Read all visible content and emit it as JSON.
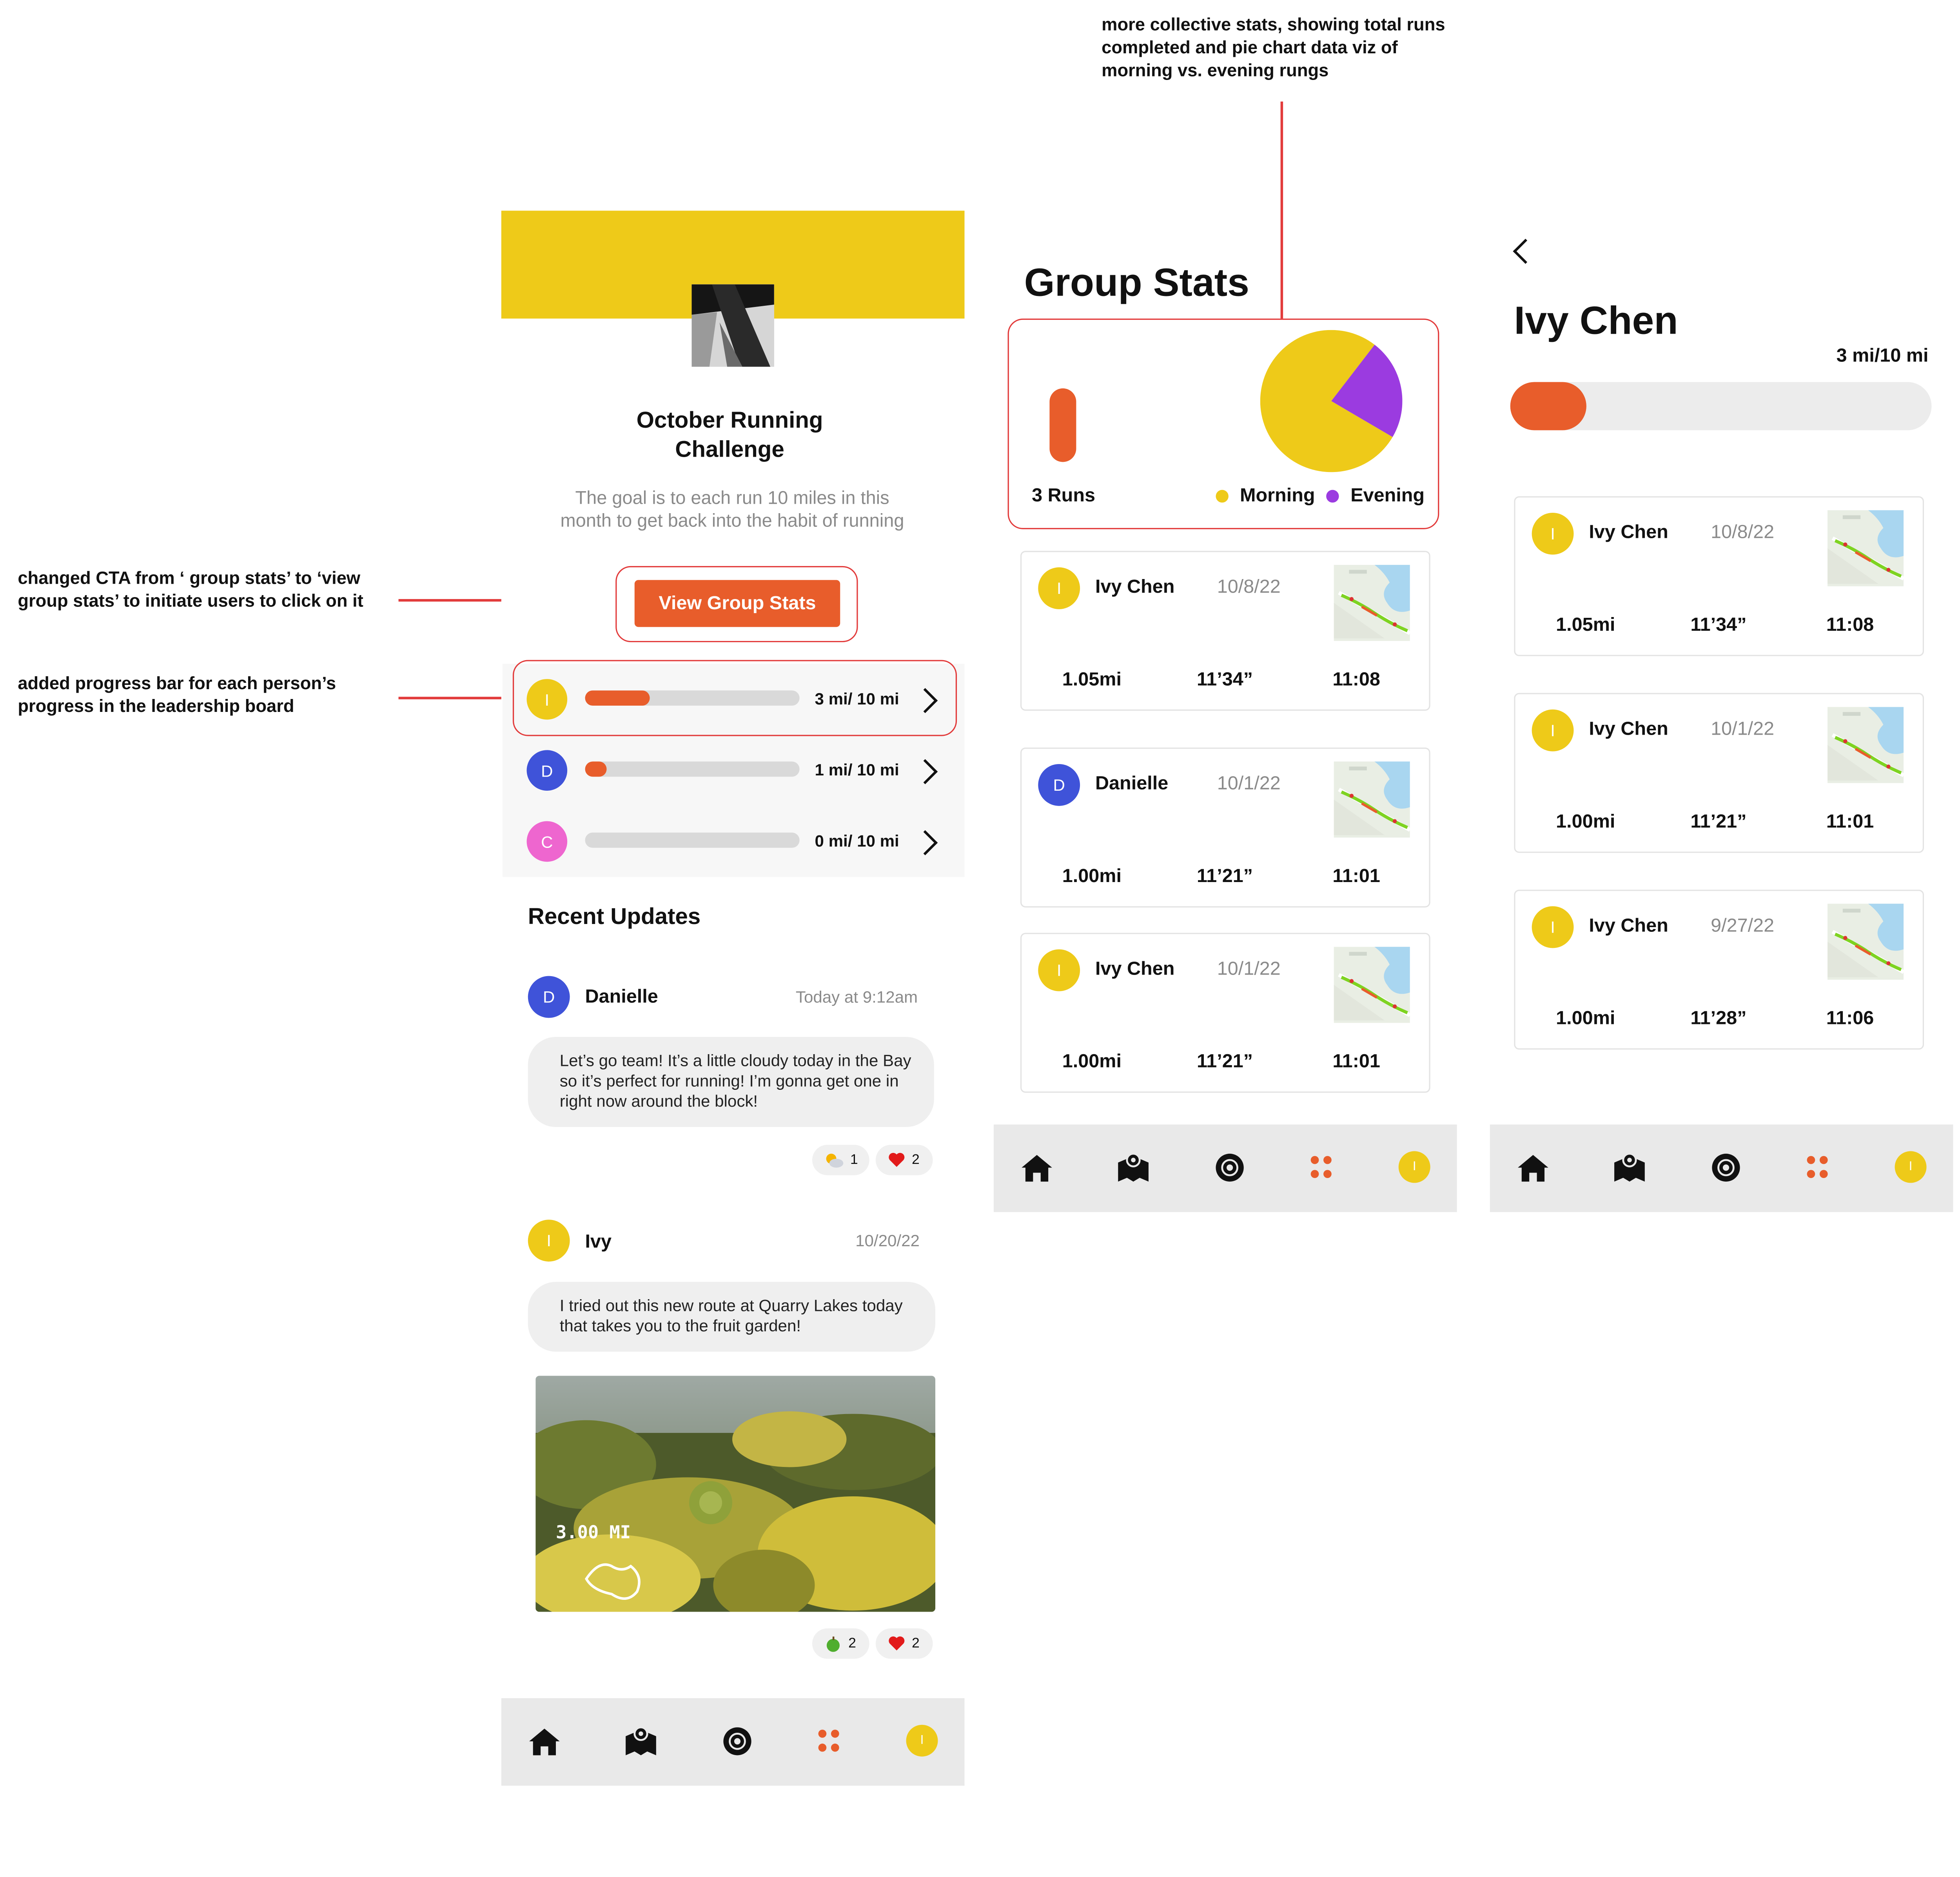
{
  "annotations": {
    "stats_note": "more collective stats, showing total runs completed and pie chart data viz of morning vs. evening rungs",
    "cta_note": "changed CTA from ‘ group stats’ to ‘view group stats’ to initiate users to click on it",
    "progress_note": "added progress bar for each person’s progress in the leadership board"
  },
  "colors": {
    "accent": "#e85d2b",
    "yellow": "#eeca19",
    "purple": "#9b3be0",
    "blue": "#3f53d9",
    "pink": "#ee66cf"
  },
  "challenge": {
    "title": "October Running Challenge",
    "description": "The goal is to each run 10 miles in this month to get back into the habit of running",
    "cta_label": "View Group Stats"
  },
  "leaderboard": [
    {
      "initial": "I",
      "color": "yellow",
      "progress": 0.3,
      "label": "3 mi/ 10 mi"
    },
    {
      "initial": "D",
      "color": "blue",
      "progress": 0.1,
      "label": "1 mi/ 10 mi"
    },
    {
      "initial": "C",
      "color": "pink",
      "progress": 0.0,
      "label": "0 mi/ 10 mi"
    }
  ],
  "recent_updates": {
    "heading": "Recent Updates",
    "posts": [
      {
        "initial": "D",
        "author": "Danielle",
        "time": "Today at 9:12am",
        "text": "Let’s go team! It’s a little cloudy today in the Bay so it’s perfect for running! I’m gonna get one in right now around the block!",
        "reactions": [
          {
            "icon": "sun-cloud-icon",
            "count": "1"
          },
          {
            "icon": "heart-icon",
            "count": "2"
          }
        ]
      },
      {
        "initial": "I",
        "author": "Ivy",
        "time": "10/20/22",
        "text": "I tried out this new route at Quarry Lakes today that takes you to the fruit garden!",
        "photo_label": "3.00 MI",
        "reactions": [
          {
            "icon": "apple-icon",
            "count": "2"
          },
          {
            "icon": "heart-icon",
            "count": "2"
          }
        ]
      }
    ]
  },
  "group_stats": {
    "title": "Group Stats",
    "runs_label": "3 Runs",
    "legend": [
      "Morning",
      "Evening"
    ],
    "runs": [
      {
        "initial": "I",
        "name": "Ivy Chen",
        "date": "10/8/22",
        "distance": "1.05mi",
        "pace": "11’34”",
        "time": "11:08"
      },
      {
        "initial": "D",
        "name": "Danielle",
        "date": "10/1/22",
        "distance": "1.00mi",
        "pace": "11’21”",
        "time": "11:01"
      },
      {
        "initial": "I",
        "name": "Ivy Chen",
        "date": "10/1/22",
        "distance": "1.00mi",
        "pace": "11’21”",
        "time": "11:01"
      }
    ]
  },
  "chart_data": {
    "type": "pie",
    "categories": [
      "Morning",
      "Evening"
    ],
    "values": [
      77,
      23
    ]
  },
  "profile": {
    "back_icon": "back-chevron-icon",
    "name": "Ivy Chen",
    "progress_label": "3 mi/10 mi",
    "progress": 0.18,
    "runs": [
      {
        "initial": "I",
        "name": "Ivy Chen",
        "date": "10/8/22",
        "distance": "1.05mi",
        "pace": "11’34”",
        "time": "11:08"
      },
      {
        "initial": "I",
        "name": "Ivy Chen",
        "date": "10/1/22",
        "distance": "1.00mi",
        "pace": "11’21”",
        "time": "11:01"
      },
      {
        "initial": "I",
        "name": "Ivy Chen",
        "date": "9/27/22",
        "distance": "1.00mi",
        "pace": "11’28”",
        "time": "11:06"
      }
    ]
  },
  "nav": {
    "icons": [
      "home-icon",
      "map-icon",
      "record-icon",
      "groups-icon",
      "profile-avatar-icon"
    ],
    "profile_initial": "I"
  }
}
